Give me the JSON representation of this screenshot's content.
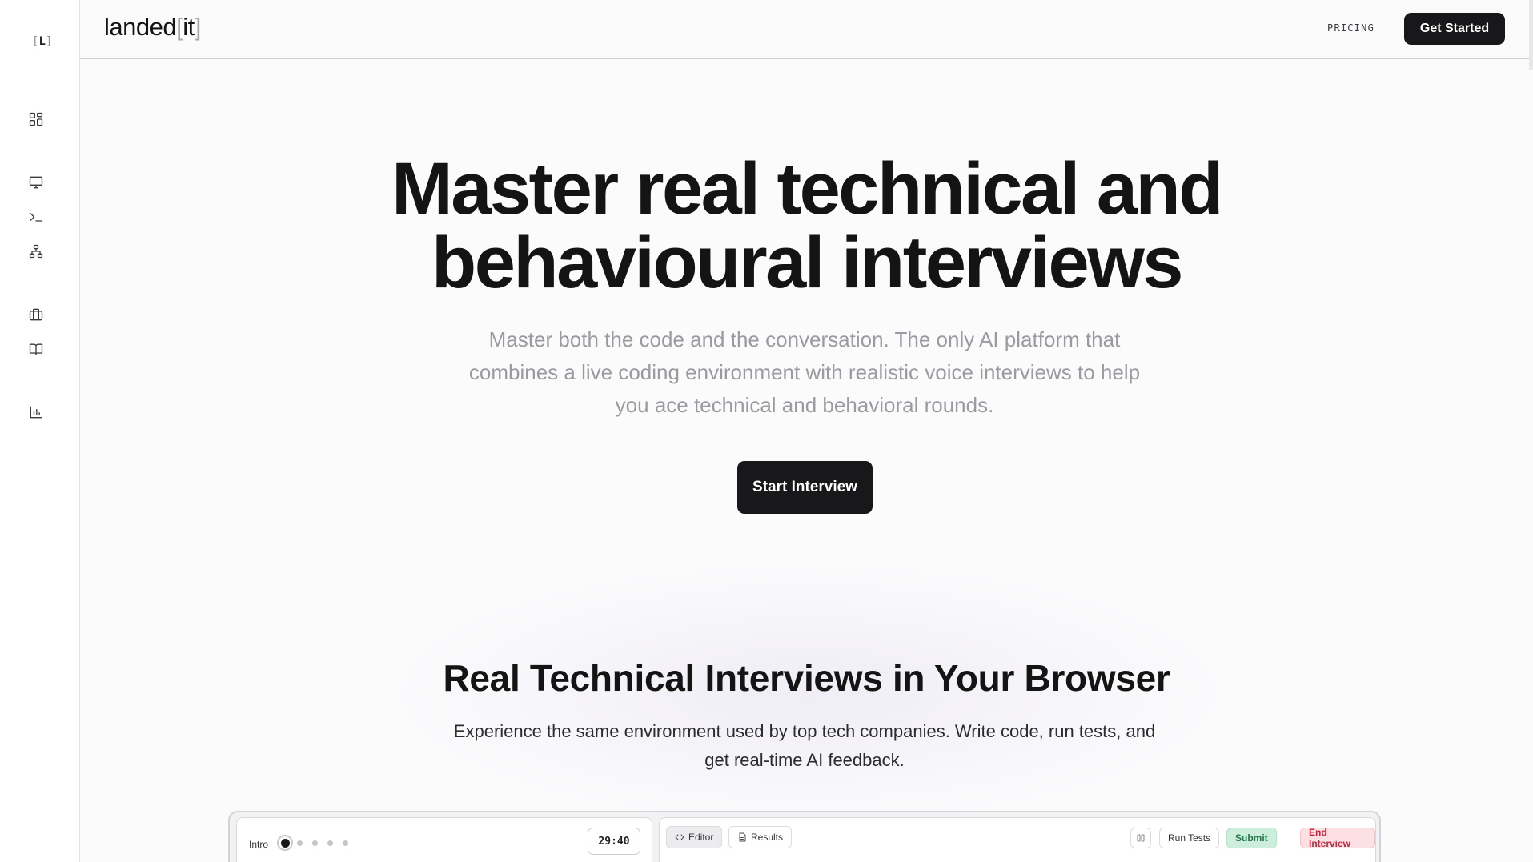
{
  "sidebar": {
    "logo": {
      "open": "[",
      "letter": "L",
      "close": "]"
    },
    "icons": [
      "dashboard-icon",
      "monitor-icon",
      "terminal-icon",
      "network-icon",
      "briefcase-icon",
      "book-icon",
      "chart-icon"
    ]
  },
  "header": {
    "brand": {
      "word": "landed",
      "open": "[",
      "inner": "it",
      "close": "]"
    },
    "pricing": "PRICING",
    "cta": "Get Started"
  },
  "hero": {
    "title_line1": "Master real technical and",
    "title_line2": "behavioural interviews",
    "subtitle": "Master both the code and the conversation. The only AI platform that combines a live coding environment with realistic voice interviews to help you ace technical and behavioral rounds.",
    "cta": "Start Interview"
  },
  "section": {
    "title": "Real Technical Interviews in Your Browser",
    "subtitle": "Experience the same environment used by top tech companies. Write code, run tests, and get real-time AI feedback."
  },
  "mockup": {
    "stage_label": "Intro",
    "timer": "29:40",
    "tabs": {
      "editor": "Editor",
      "results": "Results"
    },
    "actions": {
      "run": "Run Tests",
      "submit": "Submit",
      "end": "End Interview"
    }
  },
  "colors": {
    "primary": "#18181b",
    "muted": "#9a9aa0",
    "submit_bg": "#cdeedd",
    "end_bg": "#fde0e4",
    "end_text": "#c0263d"
  }
}
